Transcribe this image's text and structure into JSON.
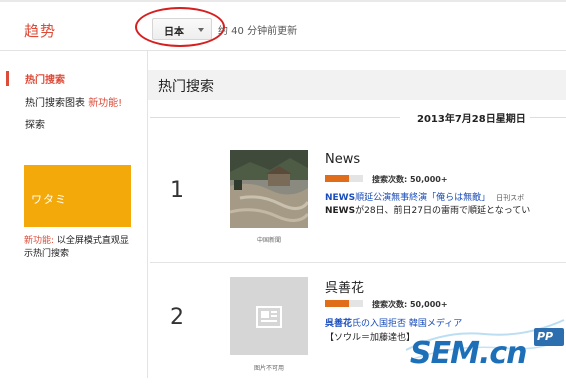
{
  "header": {
    "logo": "趋势",
    "country": "日本",
    "updated": "约 40 分钟前更新"
  },
  "sidebar": {
    "items": [
      {
        "label": "热门搜索"
      },
      {
        "label": "热门搜索图表",
        "badge": "新功能!"
      },
      {
        "label": "探索"
      }
    ],
    "promo": {
      "image_text": "ワタミ",
      "badge": "新功能:",
      "text": "以全屏模式直观显示热门搜索"
    }
  },
  "main": {
    "title": "热门搜索",
    "date": "2013年7月28日星期日",
    "items": [
      {
        "rank": "1",
        "term": "News",
        "count": "搜索次数: 50,000+",
        "bar_fill": 0.63,
        "image_caption": "中国新聞",
        "headline_bold": "NEWS",
        "headline_rest": "順延公演無事終演「俺らは無敵」",
        "source": "日刊スポ",
        "snippet_bold": "NEWS",
        "snippet_rest": "が28日、前日27日の雷雨で順延となってい"
      },
      {
        "rank": "2",
        "term": "呉善花",
        "count": "搜索次数: 50,000+",
        "bar_fill": 0.63,
        "image_caption": "图片不可用",
        "headline_bold": "呉善花",
        "headline_rest": "氏の入国拒否 韓国メディア",
        "source": "",
        "snippet_bold": "",
        "snippet_rest": "【ソウル＝加藤達也】"
      }
    ]
  },
  "watermark": {
    "text": "SEM.cn",
    "sub": "PP"
  },
  "colors": {
    "brand_red": "#dd4b39",
    "bar_orange": "#e06d1a",
    "promo_yellow": "#f4a90b",
    "link_blue": "#1a4dba"
  }
}
